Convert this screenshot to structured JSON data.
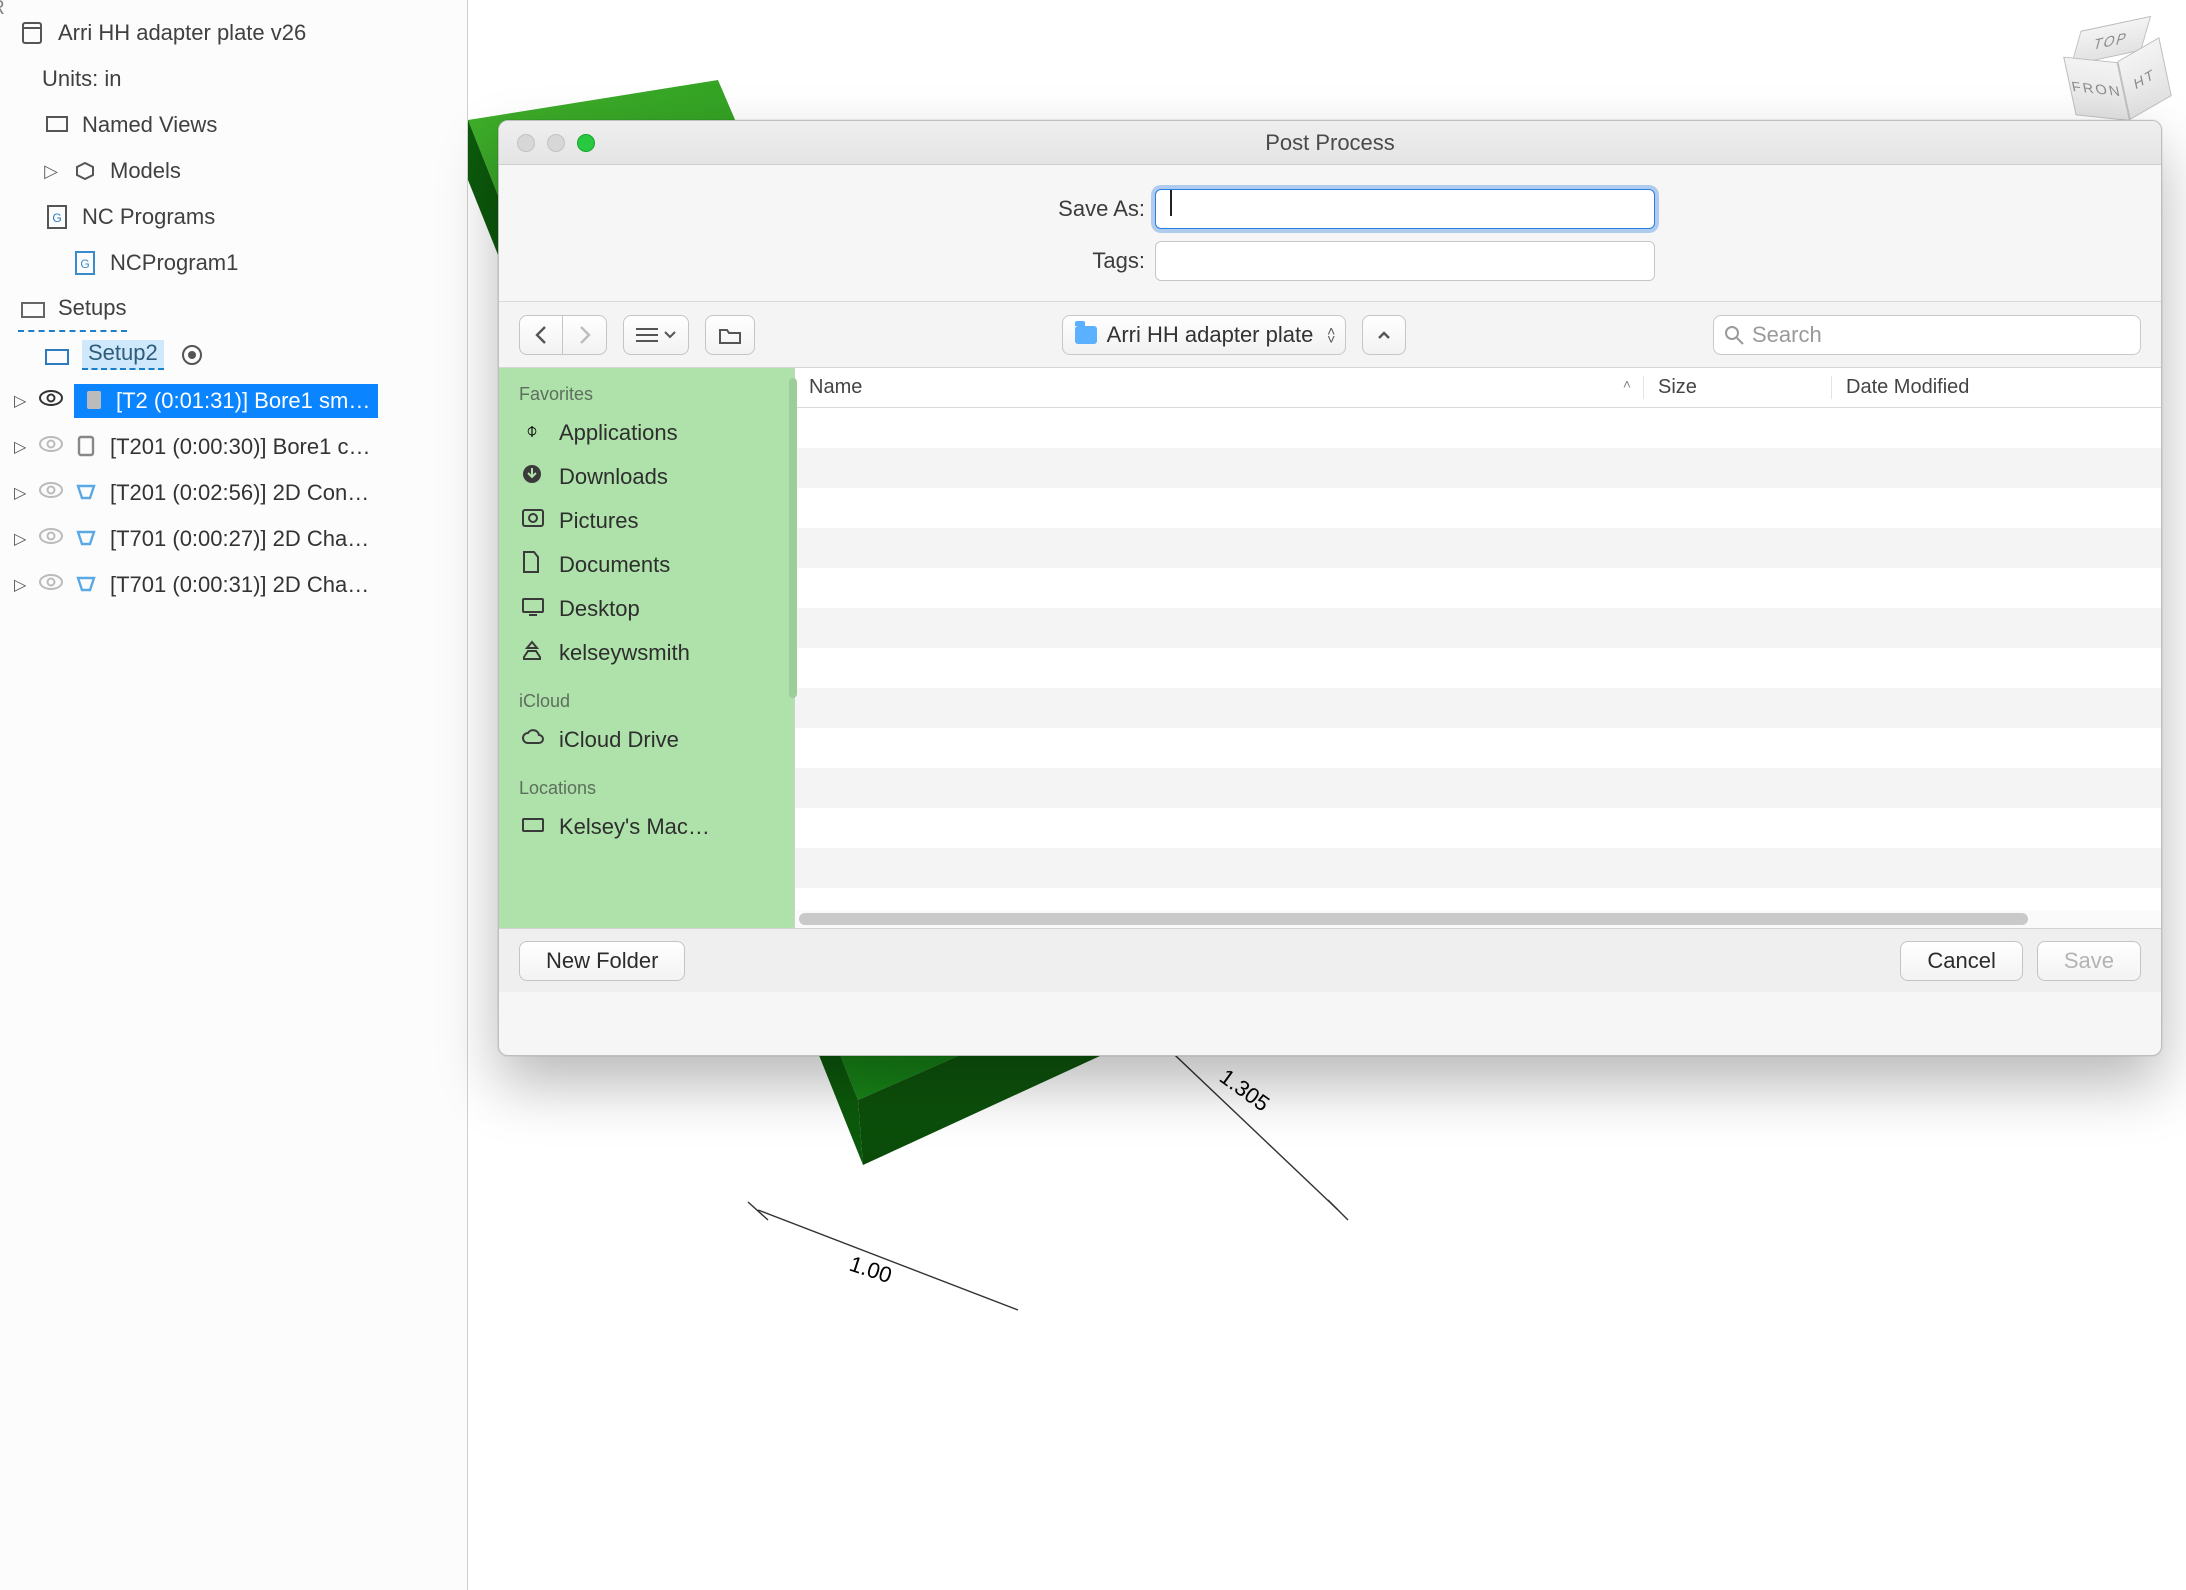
{
  "browser": {
    "header_fragment": "ER",
    "file": "Arri HH adapter plate v26",
    "units": "Units: in",
    "named_views": "Named Views",
    "models": "Models",
    "nc_programs": "NC Programs",
    "nc_program1": "NCProgram1",
    "setups": "Setups",
    "setup2": "Setup2",
    "ops": [
      {
        "label": "[T2 (0:01:31)] Bore1 sm…",
        "selected": true,
        "visible": true,
        "iconColor": "#888"
      },
      {
        "label": "[T201 (0:00:30)] Bore1 c…",
        "selected": false,
        "visible": false,
        "iconColor": "#888"
      },
      {
        "label": "[T201 (0:02:56)] 2D Con…",
        "selected": false,
        "visible": false,
        "iconColor": "#5aa9e6"
      },
      {
        "label": "[T701 (0:00:27)] 2D Cha…",
        "selected": false,
        "visible": false,
        "iconColor": "#5aa9e6"
      },
      {
        "label": "[T701 (0:00:31)] 2D Cha…",
        "selected": false,
        "visible": false,
        "iconColor": "#5aa9e6"
      }
    ]
  },
  "viewcube": {
    "top": "TOP",
    "front": "FRON",
    "right": "HT"
  },
  "part_dimensions": {
    "d1": "1.305",
    "d2": "1.00"
  },
  "dialog": {
    "title": "Post Process",
    "save_as_label": "Save As:",
    "save_as_value": "",
    "tags_label": "Tags:",
    "tags_value": "",
    "folder_name": "Arri HH adapter plate",
    "search_placeholder": "Search",
    "columns": {
      "name": "Name",
      "size": "Size",
      "date": "Date Modified"
    },
    "sidebar": {
      "favorites_title": "Favorites",
      "favorites": [
        "Applications",
        "Downloads",
        "Pictures",
        "Documents",
        "Desktop",
        "kelseywsmith"
      ],
      "icloud_title": "iCloud",
      "icloud": [
        "iCloud Drive"
      ],
      "locations_title": "Locations",
      "locations": [
        "Kelsey's Mac…"
      ]
    },
    "buttons": {
      "new_folder": "New Folder",
      "cancel": "Cancel",
      "save": "Save"
    }
  }
}
